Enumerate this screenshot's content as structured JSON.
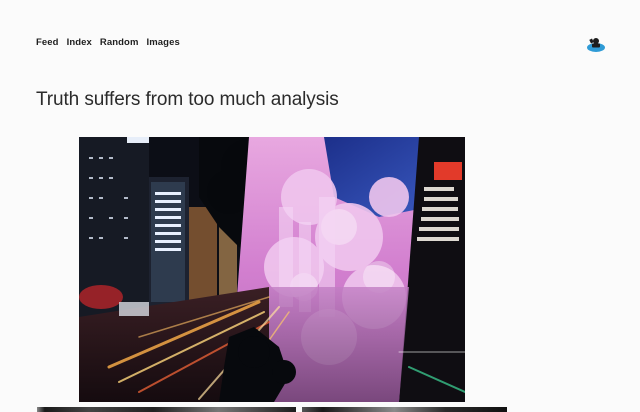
{
  "nav": {
    "items": [
      {
        "label": "Feed"
      },
      {
        "label": "Index"
      },
      {
        "label": "Random"
      },
      {
        "label": "Images"
      }
    ]
  },
  "avatar": {
    "icon": "avatar-icon"
  },
  "post": {
    "title": "Truth suffers from too much analysis"
  },
  "colors": {
    "background": "#fbfbfb",
    "text": "#1e1e1e",
    "avatar_blue": "#2f9bd6"
  }
}
